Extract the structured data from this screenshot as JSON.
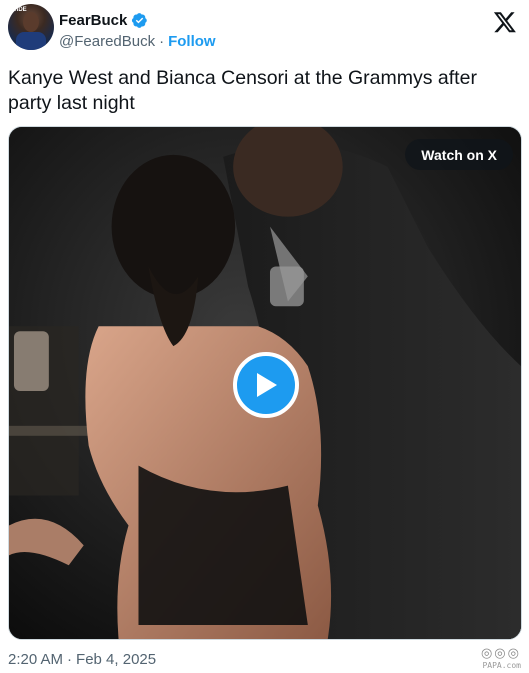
{
  "author": {
    "display_name": "FearBuck",
    "handle": "@FearedBuck",
    "separator": "·",
    "follow_label": "Follow",
    "verified_icon": "verified-badge-icon",
    "avatar_text": "WIDE"
  },
  "platform_icon": "x-logo-icon",
  "tweet": {
    "text": "Kanye West and Bianca Censori at the Grammys after party last night"
  },
  "media": {
    "watch_label": "Watch on X",
    "play_icon": "play-icon"
  },
  "timestamp": {
    "time": "2:20 AM",
    "separator": "·",
    "date": "Feb 4, 2025"
  },
  "watermark": {
    "glyphs": "◎◎◎",
    "text": "PAPA.com"
  },
  "colors": {
    "accent": "#1d9bf0",
    "text_primary": "#0f1419",
    "text_secondary": "#536471",
    "border": "#cfd9de"
  }
}
